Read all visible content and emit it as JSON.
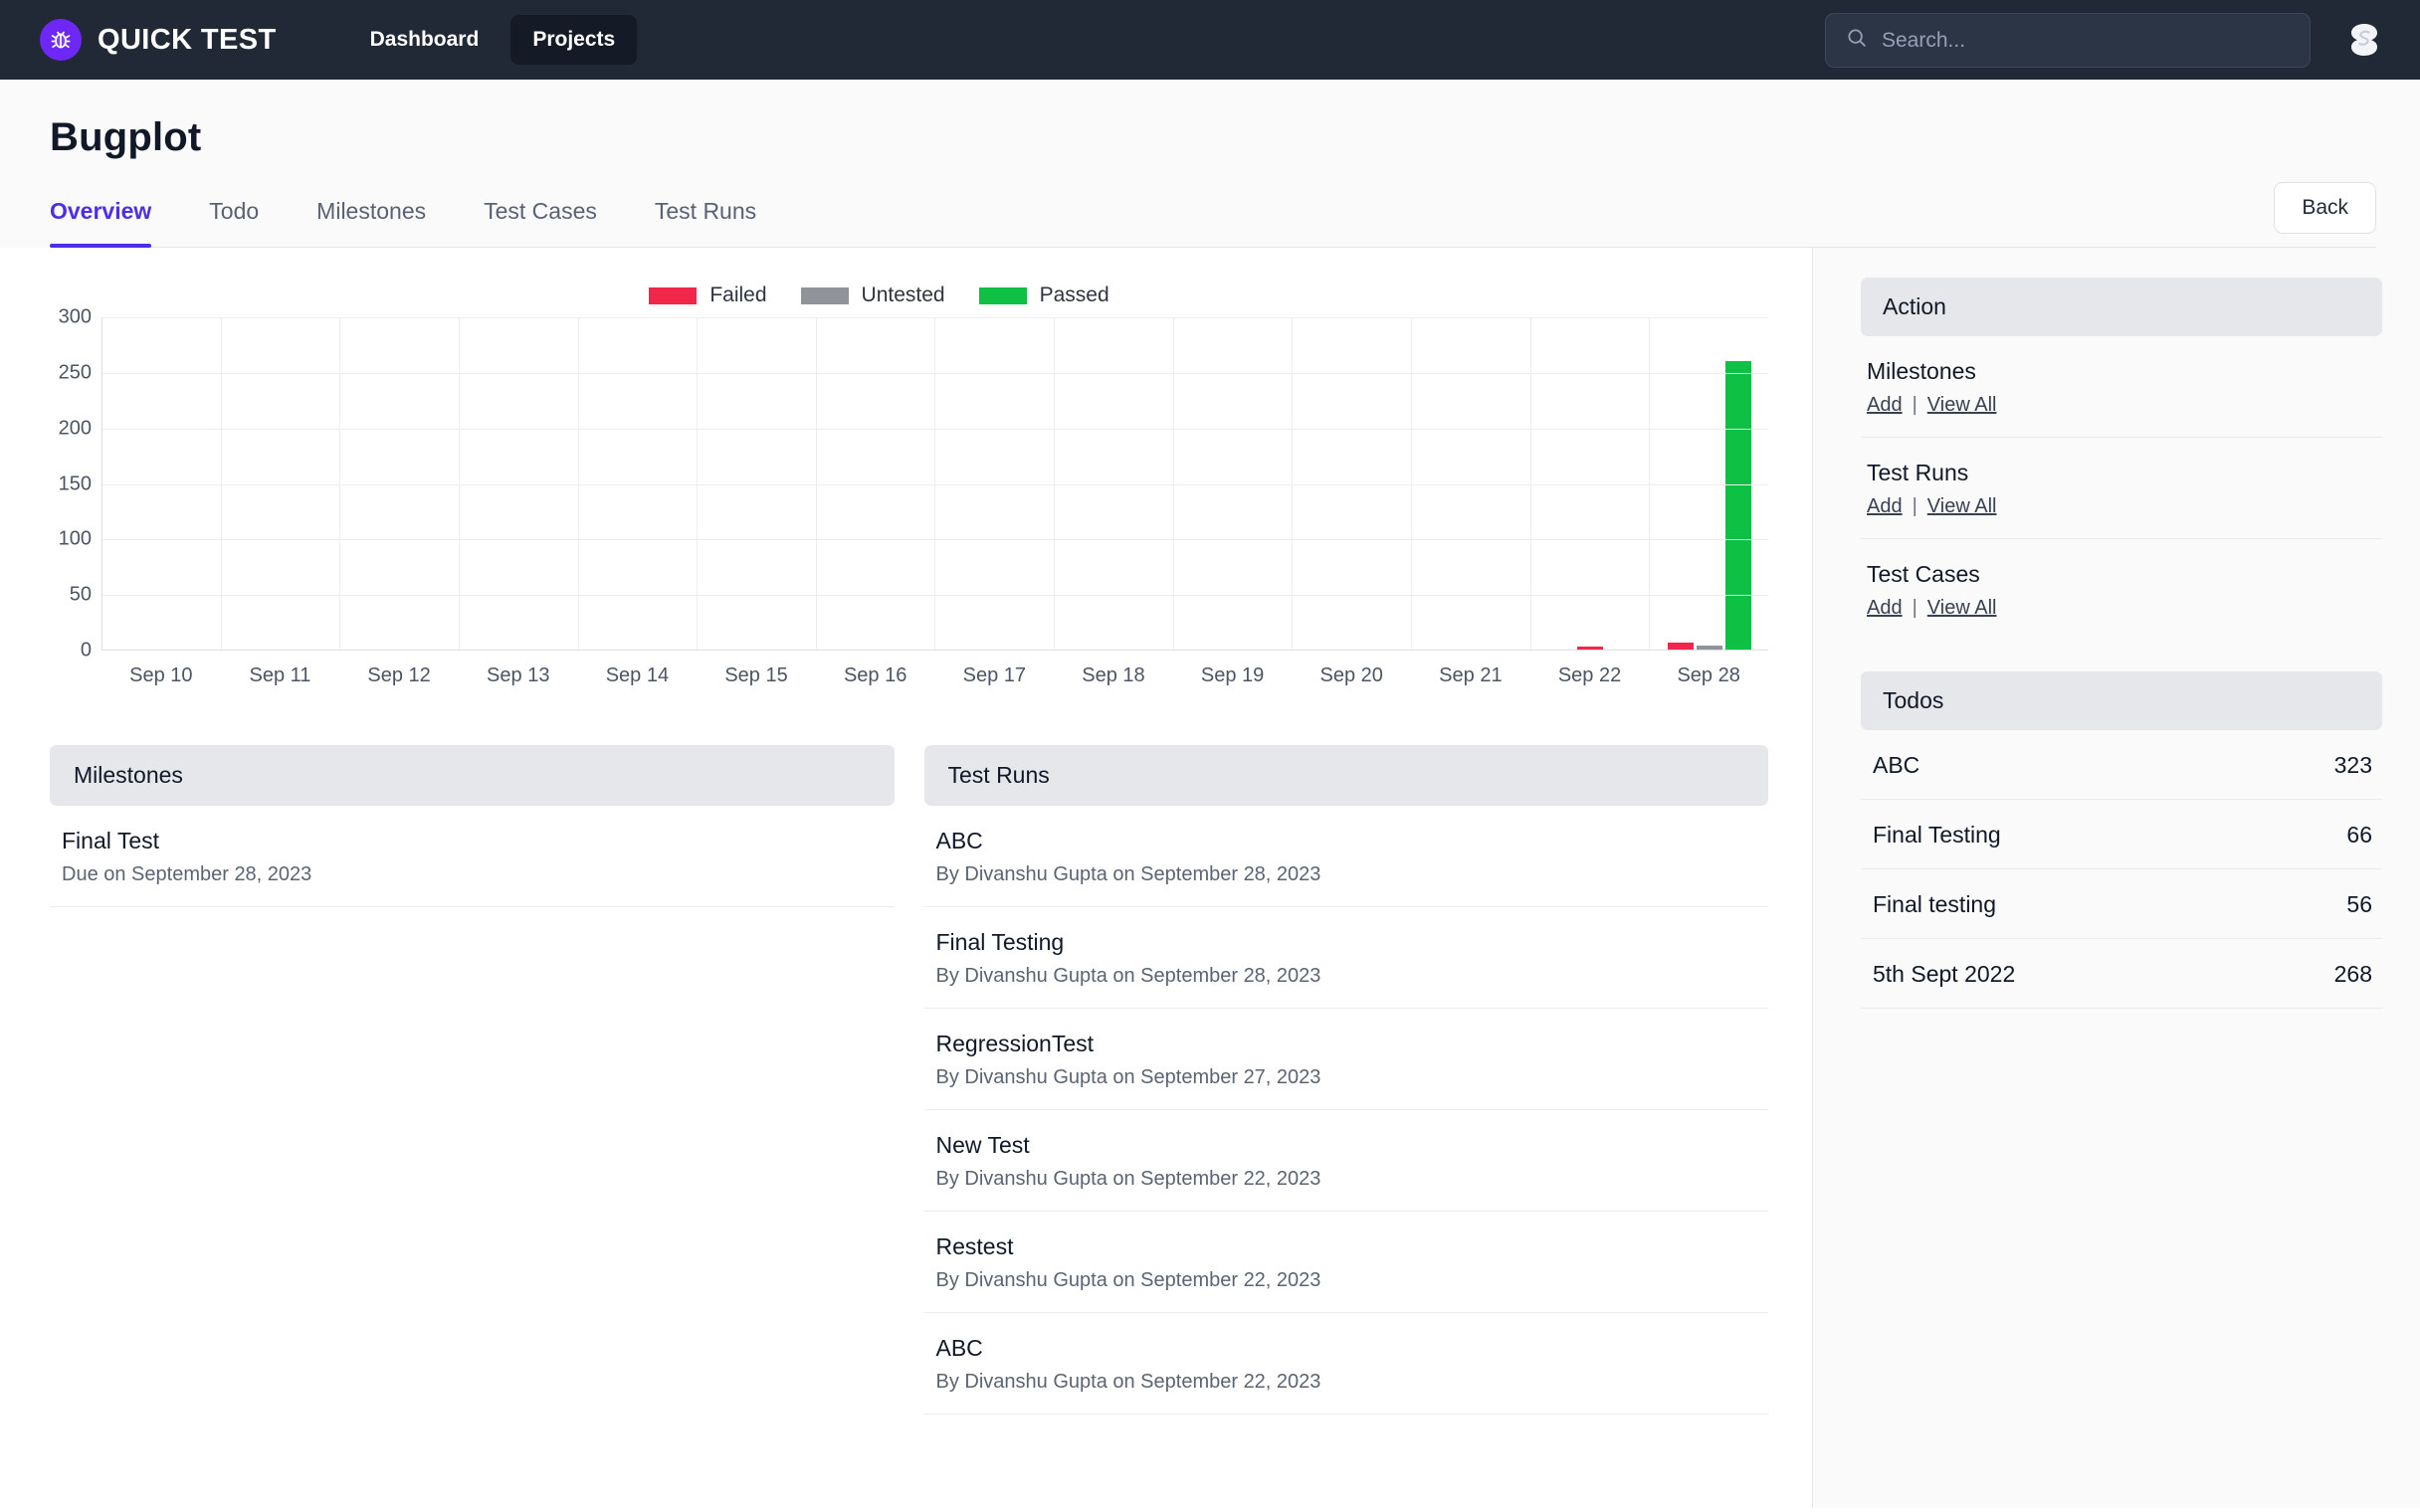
{
  "topnav": {
    "brand_name": "QUICK TEST",
    "brand_icon": "bug-icon",
    "links": [
      {
        "label": "Dashboard",
        "active": false
      },
      {
        "label": "Projects",
        "active": true
      }
    ],
    "search": {
      "value": "",
      "placeholder": "Search...",
      "icon": "search-icon"
    },
    "avatar_icon": "user-avatar"
  },
  "page": {
    "title": "Bugplot",
    "back_label": "Back",
    "tabs": [
      {
        "label": "Overview",
        "active": true
      },
      {
        "label": "Todo",
        "active": false
      },
      {
        "label": "Milestones",
        "active": false
      },
      {
        "label": "Test Cases",
        "active": false
      },
      {
        "label": "Test Runs",
        "active": false
      }
    ]
  },
  "chart_data": {
    "type": "bar",
    "title": "",
    "xlabel": "",
    "ylabel": "",
    "grid": true,
    "legend_position": "top-center",
    "ylim": [
      0,
      300
    ],
    "yticks": [
      300,
      250,
      200,
      150,
      100,
      50,
      0
    ],
    "categories": [
      "Sep 10",
      "Sep 11",
      "Sep 12",
      "Sep 13",
      "Sep 14",
      "Sep 15",
      "Sep 16",
      "Sep 17",
      "Sep 18",
      "Sep 19",
      "Sep 20",
      "Sep 21",
      "Sep 22",
      "Sep 28"
    ],
    "series": [
      {
        "name": "Failed",
        "color": "#f0264b",
        "values": [
          0,
          0,
          0,
          0,
          0,
          0,
          0,
          0,
          0,
          0,
          0,
          0,
          3,
          6
        ]
      },
      {
        "name": "Untested",
        "color": "#909399",
        "values": [
          0,
          0,
          0,
          0,
          0,
          0,
          0,
          0,
          0,
          0,
          0,
          0,
          0,
          4
        ]
      },
      {
        "name": "Passed",
        "color": "#0ec043",
        "values": [
          0,
          0,
          0,
          0,
          0,
          0,
          0,
          0,
          0,
          0,
          0,
          0,
          0,
          260
        ]
      }
    ]
  },
  "milestones_panel": {
    "header": "Milestones",
    "rows": [
      {
        "title": "Final Test",
        "subtitle": "Due on September 28, 2023"
      }
    ]
  },
  "testruns_panel": {
    "header": "Test Runs",
    "rows": [
      {
        "title": "ABC",
        "subtitle": "By Divanshu Gupta on September 28, 2023"
      },
      {
        "title": "Final Testing",
        "subtitle": "By Divanshu Gupta on September 28, 2023"
      },
      {
        "title": "RegressionTest",
        "subtitle": "By Divanshu Gupta on September 27, 2023"
      },
      {
        "title": "New Test",
        "subtitle": "By Divanshu Gupta on September 22, 2023"
      },
      {
        "title": "Restest",
        "subtitle": "By Divanshu Gupta on September 22, 2023"
      },
      {
        "title": "ABC",
        "subtitle": "By Divanshu Gupta on September 22, 2023"
      }
    ]
  },
  "sidebar": {
    "action_header": "Action",
    "groups": [
      {
        "title": "Milestones",
        "add_label": "Add",
        "separator": "|",
        "view_all_label": "View All"
      },
      {
        "title": "Test Runs",
        "add_label": "Add",
        "separator": "|",
        "view_all_label": "View All"
      },
      {
        "title": "Test Cases",
        "add_label": "Add",
        "separator": "|",
        "view_all_label": "View All"
      }
    ],
    "todos_header": "Todos",
    "todos": [
      {
        "label": "ABC",
        "count": "323"
      },
      {
        "label": "Final Testing",
        "count": "66"
      },
      {
        "label": "Final testing",
        "count": "56"
      },
      {
        "label": "5th Sept 2022",
        "count": "268"
      }
    ]
  }
}
